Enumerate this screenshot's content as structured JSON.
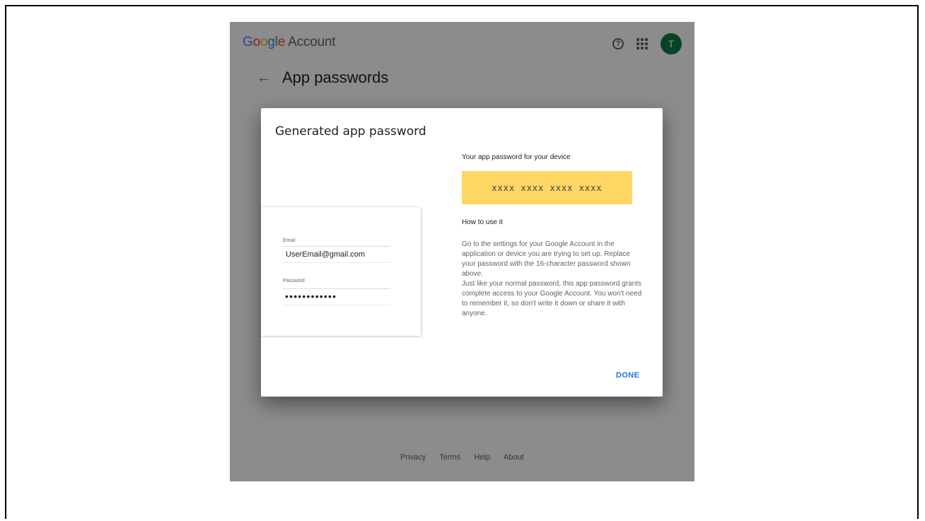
{
  "header": {
    "logo_text": {
      "g1": "G",
      "g2": "o",
      "g3": "o",
      "g4": "g",
      "g5": "l",
      "g6": "e",
      "account": "Account"
    },
    "help_icon": "help-icon",
    "apps_icon": "apps-grid-icon",
    "avatar_initial": "T"
  },
  "page": {
    "back_icon": "arrow-back-icon",
    "title": "App passwords"
  },
  "background": {
    "footer_links": [
      "Privacy",
      "Terms",
      "Help",
      "About"
    ]
  },
  "dialog": {
    "title": "Generated app password",
    "illustration": {
      "email_label": "Email",
      "email_value": "UserEmail@gmail.com",
      "password_label": "Password",
      "password_value": "••••••••••••"
    },
    "password_label": "Your app password for your device",
    "password_value": "xxxx xxxx xxxx xxxx",
    "howto_label": "How to use it",
    "howto_paragraph1": "Go to the settings for your Google Account in the application or device you are trying to set up. Replace your password with the 16-character password shown above.",
    "howto_paragraph2": "Just like your normal password, this app password grants complete access to your Google Account. You won't need to remember it, so don't write it down or share it with anyone.",
    "done_label": "DONE"
  },
  "colors": {
    "password_highlight": "#fdd663",
    "done_button": "#1a73e8",
    "avatar": "#0f7b45"
  }
}
